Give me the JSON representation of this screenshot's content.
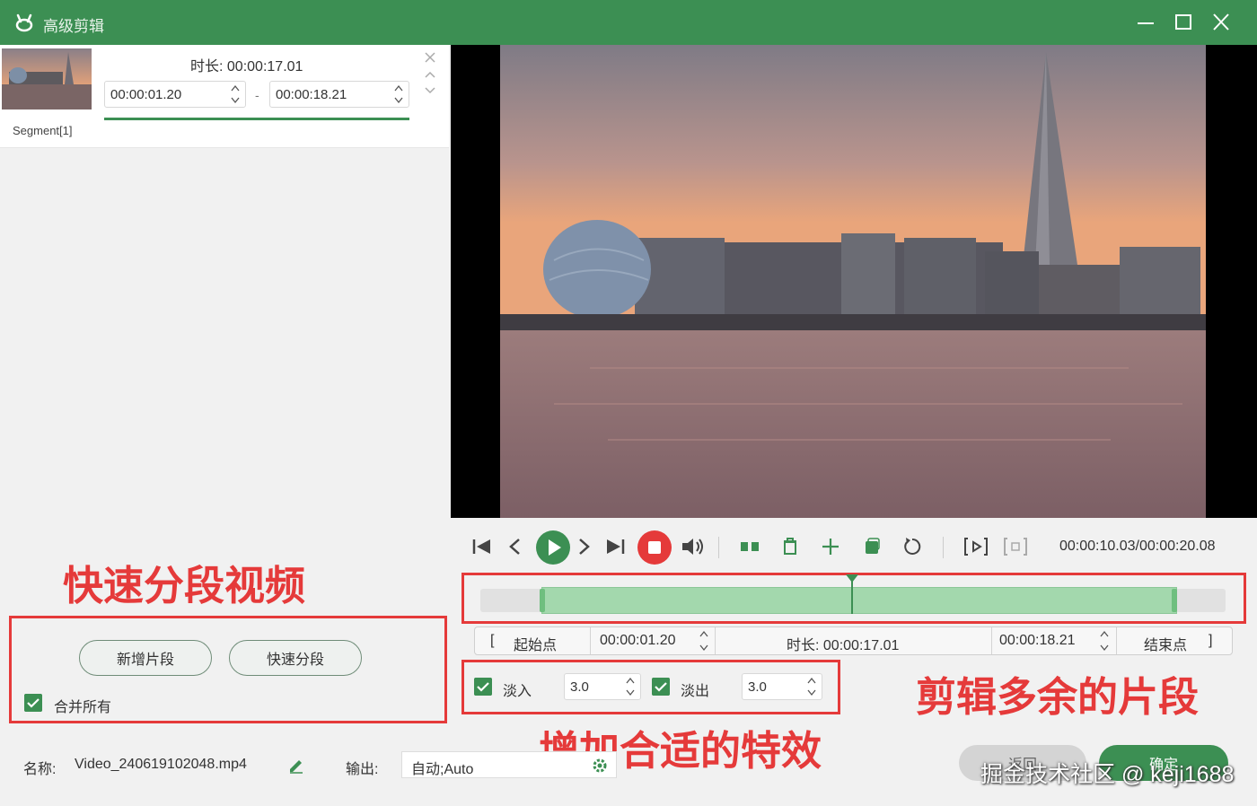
{
  "window": {
    "title": "高级剪辑"
  },
  "segment": {
    "label": "Segment[1]",
    "duration_label": "时长:",
    "duration_value": "00:00:17.01",
    "start": "00:00:01.20",
    "end": "00:00:18.21",
    "dash": "-"
  },
  "annotations": {
    "split": "快速分段视频",
    "trim": "剪辑多余的片段",
    "effects": "增加合适的特效"
  },
  "split_controls": {
    "new_segment": "新增片段",
    "quick_split": "快速分段",
    "merge_all": "合并所有"
  },
  "player": {
    "time": "00:00:10.03/00:00:20.08",
    "position_fraction": 0.5
  },
  "range": {
    "start_bracket": "[",
    "start_label": "起始点",
    "start_value": "00:00:01.20",
    "duration_label": "时长:",
    "duration_value": "00:00:17.01",
    "end_value": "00:00:18.21",
    "end_label": "结束点",
    "end_bracket": "]"
  },
  "effects": {
    "fade_in_label": "淡入",
    "fade_in_value": "3.0",
    "fade_out_label": "淡出",
    "fade_out_value": "3.0"
  },
  "file": {
    "name_label": "名称:",
    "name_value": "Video_240619102048.mp4",
    "output_label": "输出:",
    "output_value": "自动;Auto"
  },
  "buttons": {
    "cancel": "返回",
    "confirm": "确定"
  },
  "watermark": "掘金技术社区 @ keji1688",
  "colors": {
    "accent": "#3c8f53",
    "annotation": "#e53a3a",
    "stop": "#e53a3a",
    "timeline_selection": "#a3d8ad"
  }
}
